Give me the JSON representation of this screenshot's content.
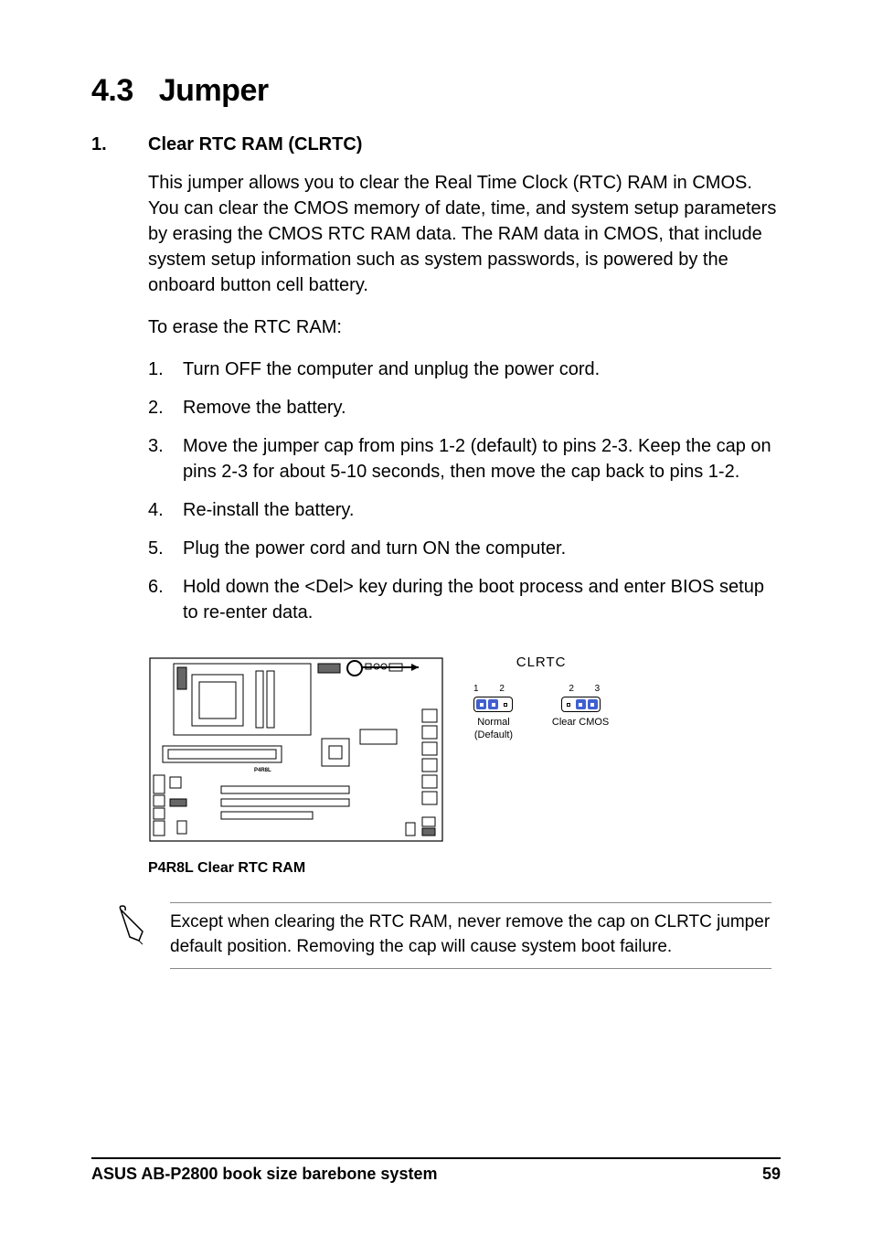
{
  "section": {
    "num": "4.3",
    "title": "Jumper"
  },
  "item": {
    "num": "1.",
    "title": "Clear RTC RAM (CLRTC)"
  },
  "para1": "This jumper allows you to clear the  Real Time Clock (RTC) RAM in CMOS. You can clear the CMOS memory of date, time, and system setup parameters by erasing the CMOS RTC RAM data. The RAM data in CMOS, that include system setup information such as system passwords, is powered by the onboard button cell battery.",
  "para2": "To erase the RTC RAM:",
  "steps": [
    {
      "n": "1.",
      "t": "Turn OFF the computer and unplug the power cord."
    },
    {
      "n": "2.",
      "t": "Remove the battery."
    },
    {
      "n": "3.",
      "t": "Move the jumper cap from pins 1-2 (default) to pins 2-3. Keep the cap on pins 2-3 for about 5-10 seconds, then move the cap back to pins 1-2."
    },
    {
      "n": "4.",
      "t": "Re-install the battery."
    },
    {
      "n": "5.",
      "t": "Plug the power cord and turn ON the computer."
    },
    {
      "n": "6.",
      "t": "Hold down the <Del> key during the boot process and enter BIOS setup to re-enter data."
    }
  ],
  "diagram": {
    "board_label": "P4R8L",
    "jumper_label": "CLRTC",
    "opt1": {
      "pins": "1 2",
      "name": "Normal",
      "sub": "(Default)"
    },
    "opt2": {
      "pins": "2 3",
      "name": "Clear CMOS",
      "sub": ""
    },
    "caption": "P4R8L Clear RTC RAM"
  },
  "note": "Except when clearing the RTC RAM, never remove the cap on CLRTC jumper default position. Removing the cap will cause system boot failure.",
  "footer": {
    "left": "ASUS AB-P2800 book size barebone system",
    "right": "59"
  }
}
